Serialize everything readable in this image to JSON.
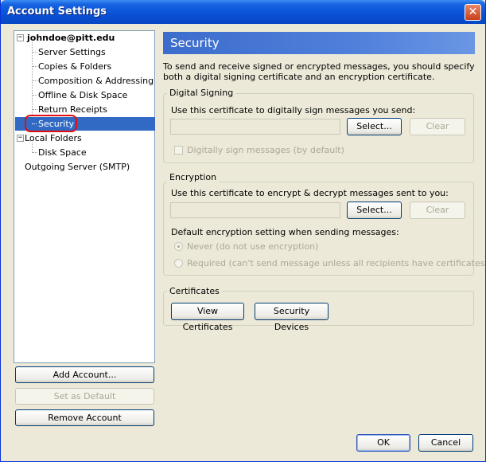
{
  "window": {
    "title": "Account Settings",
    "close_label": "✕"
  },
  "tree": {
    "account": "johndoe@pitt.edu",
    "account_items": [
      "Server Settings",
      "Copies & Folders",
      "Composition & Addressing",
      "Offline & Disk Space",
      "Return Receipts",
      "Security"
    ],
    "local_folders": "Local Folders",
    "local_items": [
      "Disk Space"
    ],
    "outgoing": "Outgoing Server (SMTP)",
    "selected": "Security",
    "expander_symbol": "−"
  },
  "left_buttons": {
    "add_account": "Add Account...",
    "set_default": "Set as Default",
    "remove_account": "Remove Account"
  },
  "panel": {
    "title": "Security",
    "description": "To send and receive signed or encrypted messages, you should specify both a digital signing certificate and an encryption certificate.",
    "signing": {
      "label": "Digital Signing",
      "prompt": "Use this certificate to digitally sign messages you send:",
      "select": "Select...",
      "clear": "Clear",
      "checkbox": "Digitally sign messages (by default)"
    },
    "encryption": {
      "label": "Encryption",
      "prompt": "Use this certificate to encrypt & decrypt messages sent to you:",
      "select": "Select...",
      "clear": "Clear",
      "default_label": "Default encryption setting when sending messages:",
      "never": "Never (do not use encryption)",
      "required": "Required (can't send message unless all recipients have certificates)"
    },
    "certificates": {
      "label": "Certificates",
      "view": "View Certificates",
      "devices": "Security Devices"
    }
  },
  "footer": {
    "ok": "OK",
    "cancel": "Cancel"
  }
}
